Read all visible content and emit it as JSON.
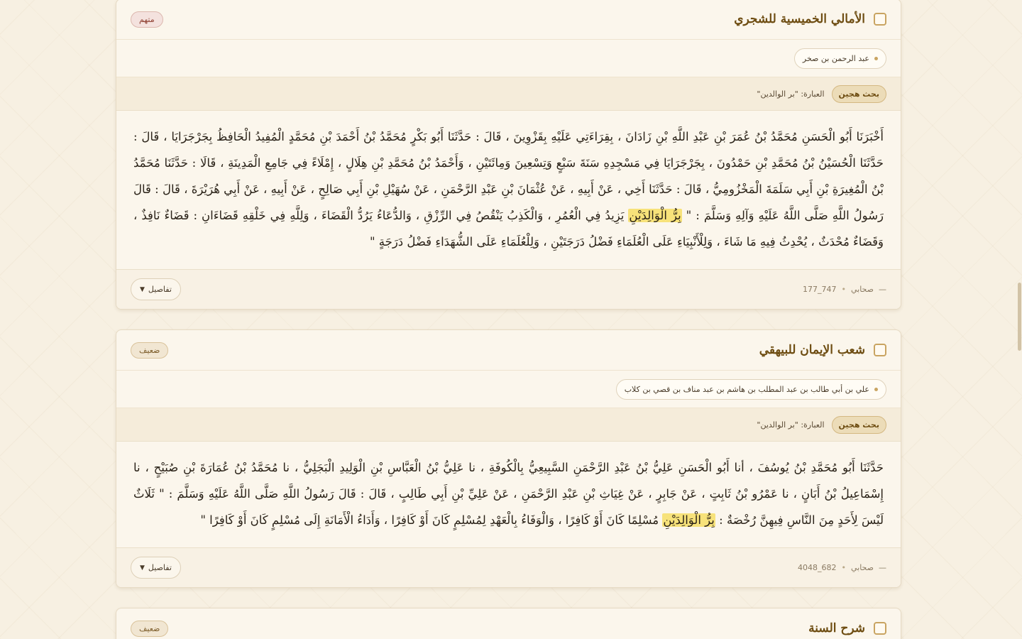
{
  "cards": [
    {
      "title": "الأمالي الخميسية للشجري",
      "grade": "متهم",
      "narrator": "عبد الرحمن بن صخر",
      "search_type": "بحث هجين",
      "search_phrase": "العبارة: \"بر الوالدين\"",
      "text_before": "أَخْبَرَنَا أَبُو الْحَسَنِ مُحَمَّدُ بْنُ عُمَرَ بْنِ عَبْدِ اللَّهِ بْنِ زَادَانَ ، بِقِرَاءَتِي عَلَيْهِ بِقَزْوِينَ ، قَالَ : حَدَّثَنَا أَبُو بَكْرٍ مُحَمَّدُ بْنُ أَحْمَدَ بْنِ مُحَمَّدٍ الْمُفِيدُ الْحَافِظُ بِجَرْجَرَايَا ، قَالَ : حَدَّثَنَا الْحُسَيْنُ بْنُ مُحَمَّدِ بْنِ حَمْدُونَ ، بِجَرْجَرَايَا فِي مَسْجِدِهِ سَنَةَ سَبْعٍ وَتِسْعِينَ وَمِائَتَيْنِ ، وَأَحْمَدُ بْنُ مُحَمَّدِ بْنِ هِلَالٍ ، إِمْلَاءً فِي جَامِعِ الْمَدِينَةِ ، قَالَا : حَدَّثَنَا مُحَمَّدُ بْنُ الْمُغِيرَةِ بْنِ أَبِي سَلَمَةَ الْمَخْزُومِيُّ ، قَالَ : حَدَّثَنَا أَخِي ، عَنْ أَبِيهِ ، عَنْ عُثْمَانَ بْنِ عَبْدِ الرَّحْمَنِ ، عَنْ سُهَيْلِ بْنِ أَبِي صَالِحٍ ، عَنْ أَبِيهِ ، عَنْ أَبِي هُرَيْرَةَ ، قَالَ : قَالَ رَسُولُ اللَّهِ صَلَّى اللَّهُ عَلَيْهِ وَآلِهِ وَسَلَّمَ : \" ",
      "highlight": "بِرُّ الْوَالِدَيْنِ",
      "text_after": " يَزِيدُ فِي الْعُمُرِ ، وَالْكَذِبُ يَنْقُصُ فِي الرِّزْقِ ، وَالدُّعَاءُ يَرُدُّ الْقَضَاءَ ، وَلِلَّهِ فِي خَلْقِهِ قَضَاءَانِ : قَضَاءٌ نَافِذٌ ، وَقَضَاءٌ مُحْدَثٌ ، يُحْدِثُ فِيهِ مَا شَاءَ ، وَلِلْأَنْبِيَاءِ عَلَى الْعُلَمَاءِ فَضْلُ دَرَجَتَيْنِ ، وَلِلْعُلَمَاءِ عَلَى الشُّهَدَاءِ فَضْلُ دَرَجَةٍ \"",
      "details_label": "تفاصيل",
      "meta_type": "صحابي",
      "meta_id": "747_177",
      "meta_dash": "—",
      "meta_sep": "•"
    },
    {
      "title": "شعب الإيمان للبيهقي",
      "grade": "ضعيف",
      "narrator": "علي بن أبي طالب بن عبد المطلب بن هاشم بن عبد مناف بن قصي بن كلاب",
      "search_type": "بحث هجين",
      "search_phrase": "العبارة: \"بر الوالدين\"",
      "text_before": "حَدَّثَنَا أَبُو مُحَمَّدِ بْنُ يُوسُفَ ، أنا أَبُو الْحَسَنِ عَلِيُّ بْنُ عَبْدِ الرَّحْمَنِ السَّبِيعِيُّ بِالْكُوفَةِ ، نا عَلِيُّ بْنُ الْعَبَّاسِ بْنِ الْوَلِيدِ الْبَجَلِيُّ ، نا مُحَمَّدُ بْنُ عُمَارَةَ بْنِ صُبَيْحٍ ، نا إِسْمَاعِيلُ بْنُ أَبَانٍ ، نا عَمْرُو بْنُ ثَابِتٍ ، عَنْ جَابِرٍ ، عَنْ غِيَاثِ بْنِ عَبْدِ الرَّحْمَنِ ، عَنْ عَلِيِّ بْنِ أَبِي طَالِبٍ ، قَالَ : قَالَ رَسُولُ اللَّهِ صَلَّى اللَّهُ عَلَيْهِ وَسَلَّمَ : \" ثَلَاثٌ لَيْسَ لِأَحَدٍ مِنَ النَّاسِ فِيهِنَّ رُخْصَةٌ : ",
      "highlight": "بِرُّ الْوَالِدَيْنِ",
      "text_after": " مُسْلِمًا كَانَ أَوْ كَافِرًا ، وَالْوَفَاءُ بِالْعَهْدِ لِمُسْلِمٍ كَانَ أَوْ كَافِرًا ، وَأَدَاءُ الْأَمَانَةِ إِلَى مُسْلِمٍ كَانَ أَوْ كَافِرًا \"",
      "details_label": "تفاصيل",
      "meta_type": "صحابي",
      "meta_id": "682_4048",
      "meta_dash": "—",
      "meta_sep": "•"
    },
    {
      "title": "شرح السنة",
      "grade": "ضعيف"
    }
  ]
}
